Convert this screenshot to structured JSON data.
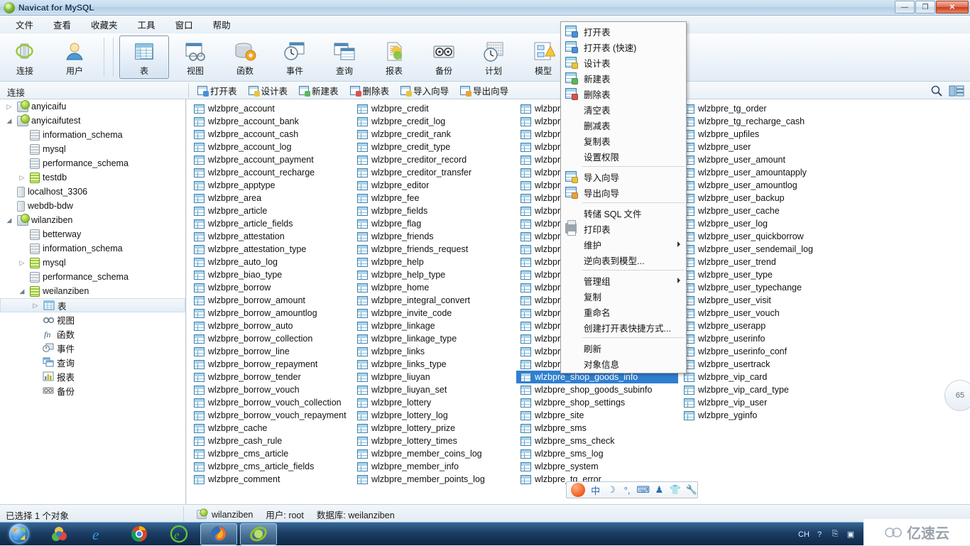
{
  "window": {
    "title": "Navicat for MySQL",
    "icon": "navicat-logo-icon",
    "minimize_label": "—",
    "maximize_label": "❐",
    "close_label": "✕"
  },
  "menubar": {
    "items": [
      {
        "label": "文件",
        "name": "menu-file"
      },
      {
        "label": "查看",
        "name": "menu-view"
      },
      {
        "label": "收藏夹",
        "name": "menu-favorites"
      },
      {
        "label": "工具",
        "name": "menu-tools"
      },
      {
        "label": "窗口",
        "name": "menu-window"
      },
      {
        "label": "帮助",
        "name": "menu-help"
      }
    ]
  },
  "toolbar": {
    "buttons": [
      {
        "label": "连接",
        "icon": "connection-icon",
        "selected": false
      },
      {
        "label": "用户",
        "icon": "user-icon",
        "selected": false
      },
      {
        "label": "表",
        "icon": "table-icon",
        "selected": true
      },
      {
        "label": "视图",
        "icon": "view-icon",
        "selected": false
      },
      {
        "label": "函数",
        "icon": "function-icon",
        "selected": false
      },
      {
        "label": "事件",
        "icon": "event-icon",
        "selected": false
      },
      {
        "label": "查询",
        "icon": "query-icon",
        "selected": false
      },
      {
        "label": "报表",
        "icon": "report-icon",
        "selected": false
      },
      {
        "label": "备份",
        "icon": "backup-icon",
        "selected": false
      },
      {
        "label": "计划",
        "icon": "schedule-icon",
        "selected": false
      },
      {
        "label": "模型",
        "icon": "model-icon",
        "selected": false
      }
    ]
  },
  "connbar": {
    "label": "连接",
    "object_buttons": [
      {
        "label": "打开表",
        "icon": "open-table-icon",
        "badge": "#4a90d9"
      },
      {
        "label": "设计表",
        "icon": "design-table-icon",
        "badge": "#e8c53a"
      },
      {
        "label": "新建表",
        "icon": "new-table-icon",
        "badge": "#5cb85c"
      },
      {
        "label": "删除表",
        "icon": "delete-table-icon",
        "badge": "#d9534f"
      },
      {
        "label": "导入向导",
        "icon": "import-wizard-icon",
        "badge": "#e8c53a"
      },
      {
        "label": "导出向导",
        "icon": "export-wizard-icon",
        "badge": "#e8a33a"
      }
    ],
    "search_icon": "search-icon",
    "view_icon": "view-mode-icon"
  },
  "sidebar": {
    "nodes": [
      {
        "label": "anyicaifu",
        "icon": "server-icon",
        "indent": 0,
        "twisty": "collapsed",
        "selected": false
      },
      {
        "label": "anyicaifutest",
        "icon": "server-icon",
        "indent": 0,
        "twisty": "expanded",
        "selected": false
      },
      {
        "label": "information_schema",
        "icon": "schema-icon",
        "indent": 1,
        "twisty": "none",
        "selected": false
      },
      {
        "label": "mysql",
        "icon": "schema-icon",
        "indent": 1,
        "twisty": "none",
        "selected": false
      },
      {
        "label": "performance_schema",
        "icon": "schema-icon",
        "indent": 1,
        "twisty": "none",
        "selected": false
      },
      {
        "label": "testdb",
        "icon": "schema-icon-green",
        "indent": 1,
        "twisty": "collapsed",
        "selected": false
      },
      {
        "label": "localhost_3306",
        "icon": "host-icon",
        "indent": 0,
        "twisty": "none",
        "selected": false
      },
      {
        "label": "webdb-bdw",
        "icon": "host-icon",
        "indent": 0,
        "twisty": "none",
        "selected": false
      },
      {
        "label": "wilanziben",
        "icon": "server-icon",
        "indent": 0,
        "twisty": "expanded",
        "selected": false
      },
      {
        "label": "betterway",
        "icon": "schema-icon",
        "indent": 1,
        "twisty": "none",
        "selected": false
      },
      {
        "label": "information_schema",
        "icon": "schema-icon",
        "indent": 1,
        "twisty": "none",
        "selected": false
      },
      {
        "label": "mysql",
        "icon": "schema-icon-green",
        "indent": 1,
        "twisty": "collapsed",
        "selected": false
      },
      {
        "label": "performance_schema",
        "icon": "schema-icon",
        "indent": 1,
        "twisty": "none",
        "selected": false
      },
      {
        "label": "weilanziben",
        "icon": "schema-icon-green",
        "indent": 1,
        "twisty": "expanded",
        "selected": false
      },
      {
        "label": "表",
        "icon": "tables-folder-icon",
        "indent": 2,
        "twisty": "collapsed",
        "selected": true
      },
      {
        "label": "视图",
        "icon": "views-folder-icon",
        "indent": 2,
        "twisty": "none",
        "selected": false
      },
      {
        "label": "函数",
        "icon": "functions-folder-icon",
        "indent": 2,
        "twisty": "none",
        "selected": false
      },
      {
        "label": "事件",
        "icon": "events-folder-icon",
        "indent": 2,
        "twisty": "none",
        "selected": false
      },
      {
        "label": "查询",
        "icon": "queries-folder-icon",
        "indent": 2,
        "twisty": "none",
        "selected": false
      },
      {
        "label": "报表",
        "icon": "reports-folder-icon",
        "indent": 2,
        "twisty": "none",
        "selected": false
      },
      {
        "label": "备份",
        "icon": "backups-folder-icon",
        "indent": 2,
        "twisty": "none",
        "selected": false
      }
    ]
  },
  "tables": {
    "selected": "wlzbpre_shop_goods_info",
    "columns": [
      [
        "wlzbpre_account",
        "wlzbpre_account_bank",
        "wlzbpre_account_cash",
        "wlzbpre_account_log",
        "wlzbpre_account_payment",
        "wlzbpre_account_recharge",
        "wlzbpre_apptype",
        "wlzbpre_area",
        "wlzbpre_article",
        "wlzbpre_article_fields",
        "wlzbpre_attestation",
        "wlzbpre_attestation_type",
        "wlzbpre_auto_log",
        "wlzbpre_biao_type",
        "wlzbpre_borrow",
        "wlzbpre_borrow_amount",
        "wlzbpre_borrow_amountlog",
        "wlzbpre_borrow_auto",
        "wlzbpre_borrow_collection",
        "wlzbpre_borrow_line",
        "wlzbpre_borrow_repayment",
        "wlzbpre_borrow_tender",
        "wlzbpre_borrow_vouch",
        "wlzbpre_borrow_vouch_collection",
        "wlzbpre_borrow_vouch_repayment",
        "wlzbpre_cache",
        "wlzbpre_cash_rule",
        "wlzbpre_cms_article",
        "wlzbpre_cms_article_fields",
        "wlzbpre_comment"
      ],
      [
        "wlzbpre_credit",
        "wlzbpre_credit_log",
        "wlzbpre_credit_rank",
        "wlzbpre_credit_type",
        "wlzbpre_creditor_record",
        "wlzbpre_creditor_transfer",
        "wlzbpre_editor",
        "wlzbpre_fee",
        "wlzbpre_fields",
        "wlzbpre_flag",
        "wlzbpre_friends",
        "wlzbpre_friends_request",
        "wlzbpre_help",
        "wlzbpre_help_type",
        "wlzbpre_home",
        "wlzbpre_integral_convert",
        "wlzbpre_invite_code",
        "wlzbpre_linkage",
        "wlzbpre_linkage_type",
        "wlzbpre_links",
        "wlzbpre_links_type",
        "wlzbpre_liuyan",
        "wlzbpre_liuyan_set",
        "wlzbpre_lottery",
        "wlzbpre_lottery_log",
        "wlzbpre_lottery_prize",
        "wlzbpre_lottery_times",
        "wlzbpre_member_coins_log",
        "wlzbpre_member_info",
        "wlzbpre_member_points_log"
      ],
      [
        "wlzbpre",
        "wlzbpre",
        "wlzbpre",
        "wlzbpre",
        "wlzbpre",
        "wlzbpre",
        "wlzbpre",
        "wlzbpre",
        "wlzbpre",
        "wlzbpre",
        "wlzbpre",
        "wlzbpre",
        "wlzbpre",
        "wlzbpre",
        "wlzbpre",
        "wlzbpre",
        "wlzbpre",
        "wlzbpre",
        "wlzbpre",
        "wlzbpre",
        "wlzbpre",
        "wlzbpre_shop_goods_info",
        "wlzbpre_shop_goods_subinfo",
        "wlzbpre_shop_settings",
        "wlzbpre_site",
        "wlzbpre_sms",
        "wlzbpre_sms_check",
        "wlzbpre_sms_log",
        "wlzbpre_system",
        "wlzbpre_tg_error"
      ],
      [
        "wlzbpre_tg_order",
        "wlzbpre_tg_recharge_cash",
        "wlzbpre_upfiles",
        "wlzbpre_user",
        "wlzbpre_user_amount",
        "wlzbpre_user_amountapply",
        "wlzbpre_user_amountlog",
        "wlzbpre_user_backup",
        "wlzbpre_user_cache",
        "wlzbpre_user_log",
        "wlzbpre_user_quickborrow",
        "wlzbpre_user_sendemail_log",
        "wlzbpre_user_trend",
        "wlzbpre_user_type",
        "wlzbpre_user_typechange",
        "wlzbpre_user_visit",
        "wlzbpre_user_vouch",
        "wlzbpre_userapp",
        "wlzbpre_userinfo",
        "wlzbpre_userinfo_conf",
        "wlzbpre_usertrack",
        "wlzbpre_vip_card",
        "wlzbpre_vip_card_type",
        "wlzbpre_vip_user",
        "wlzbpre_yginfo"
      ]
    ]
  },
  "context_menu": {
    "items": [
      {
        "label": "打开表",
        "icon": "open-table-icon",
        "badge": "#4a90d9",
        "submenu": false,
        "sep_after": false
      },
      {
        "label": "打开表 (快速)",
        "icon": "open-table-fast-icon",
        "badge": "#4a90d9",
        "submenu": false,
        "sep_after": false
      },
      {
        "label": "设计表",
        "icon": "design-table-icon",
        "badge": "#e8c53a",
        "submenu": false,
        "sep_after": false
      },
      {
        "label": "新建表",
        "icon": "new-table-icon",
        "badge": "#5cb85c",
        "submenu": false,
        "sep_after": false
      },
      {
        "label": "删除表",
        "icon": "delete-table-icon",
        "badge": "#d9534f",
        "submenu": false,
        "sep_after": false
      },
      {
        "label": "清空表",
        "icon": "",
        "badge": "",
        "submenu": false,
        "sep_after": false
      },
      {
        "label": "删减表",
        "icon": "",
        "badge": "",
        "submenu": false,
        "sep_after": false
      },
      {
        "label": "复制表",
        "icon": "",
        "badge": "",
        "submenu": false,
        "sep_after": false
      },
      {
        "label": "设置权限",
        "icon": "",
        "badge": "",
        "submenu": false,
        "sep_after": true
      },
      {
        "label": "导入向导",
        "icon": "import-wizard-icon",
        "badge": "#e8c53a",
        "submenu": false,
        "sep_after": false
      },
      {
        "label": "导出向导",
        "icon": "export-wizard-icon",
        "badge": "#e8a33a",
        "submenu": false,
        "sep_after": true
      },
      {
        "label": "转储 SQL 文件",
        "icon": "",
        "badge": "",
        "submenu": false,
        "sep_after": false
      },
      {
        "label": "打印表",
        "icon": "printer-icon",
        "badge": "",
        "submenu": false,
        "sep_after": false
      },
      {
        "label": "维护",
        "icon": "",
        "badge": "",
        "submenu": true,
        "sep_after": false
      },
      {
        "label": "逆向表到模型...",
        "icon": "",
        "badge": "",
        "submenu": false,
        "sep_after": true
      },
      {
        "label": "管理组",
        "icon": "",
        "badge": "",
        "submenu": true,
        "sep_after": false
      },
      {
        "label": "复制",
        "icon": "",
        "badge": "",
        "submenu": false,
        "sep_after": false
      },
      {
        "label": "重命名",
        "icon": "",
        "badge": "",
        "submenu": false,
        "sep_after": false
      },
      {
        "label": "创建打开表快捷方式...",
        "icon": "",
        "badge": "",
        "submenu": false,
        "sep_after": true
      },
      {
        "label": "刷新",
        "icon": "",
        "badge": "",
        "submenu": false,
        "sep_after": false
      },
      {
        "label": "对象信息",
        "icon": "",
        "badge": "",
        "submenu": false,
        "sep_after": false
      }
    ]
  },
  "ime": {
    "logo": "sogou-ime-icon",
    "buttons": [
      {
        "label": "中",
        "name": "ime-chinese-mode"
      },
      {
        "label": "☽",
        "name": "ime-moon"
      },
      {
        "label": "°,",
        "name": "ime-punctuation"
      },
      {
        "label": "⌨",
        "name": "ime-keyboard"
      },
      {
        "label": "♟",
        "name": "ime-user"
      },
      {
        "label": "👕",
        "name": "ime-skin"
      },
      {
        "label": "🔧",
        "name": "ime-toolbox"
      }
    ]
  },
  "statusbar": {
    "selection": "已选择 1 个对象",
    "connection": "wilanziben",
    "user": "用户: root",
    "database": "数据库: weilanziben"
  },
  "taskbar": {
    "start_label": "start-orb-icon",
    "items": [
      {
        "name": "taskbar-item-kugou",
        "active": false
      },
      {
        "name": "taskbar-item-internet-explorer",
        "active": false
      },
      {
        "name": "taskbar-item-chrome",
        "active": false
      },
      {
        "name": "taskbar-item-360-browser",
        "active": false
      },
      {
        "name": "taskbar-item-firefox",
        "active": true
      },
      {
        "name": "taskbar-item-navicat",
        "active": true
      }
    ],
    "tray": [
      {
        "label": "CH",
        "name": "tray-language-indicator"
      },
      {
        "label": "?",
        "name": "tray-help-icon"
      },
      {
        "label": "⎘",
        "name": "tray-show-hidden-icon"
      },
      {
        "label": "▣",
        "name": "tray-app-icon"
      },
      {
        "label": "🐧",
        "name": "tray-qq-icon"
      },
      {
        "label": "⬤",
        "name": "tray-360-shield-icon"
      },
      {
        "label": "✔",
        "name": "tray-security-icon"
      },
      {
        "label": "🔊",
        "name": "tray-volume-icon"
      },
      {
        "label": "⚑",
        "name": "tray-network-error-icon"
      },
      {
        "label": "▁▃▅",
        "name": "tray-signal-icon"
      },
      {
        "label": "🔈",
        "name": "tray-sound-icon"
      }
    ]
  },
  "watermark": {
    "icon": "cloud-icon",
    "text": "亿速云"
  },
  "right_badge": {
    "label": "65"
  }
}
